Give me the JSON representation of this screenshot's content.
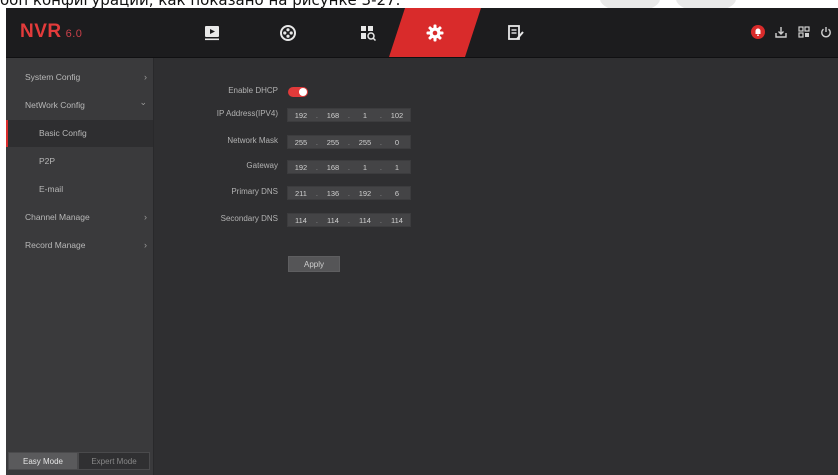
{
  "caption": {
    "text": "ооп конфигурации, как показано на рисунке 3-27."
  },
  "header": {
    "logo_text": "NVR",
    "logo_version": "6.0",
    "nav_icons": [
      "playback-icon",
      "channel-icon",
      "search-icon",
      "settings-icon",
      "maintenance-icon"
    ],
    "active_nav": "settings-icon",
    "right_icons": [
      "alarm-icon",
      "backup-icon",
      "qr-icon",
      "power-icon"
    ]
  },
  "sidebar": {
    "items": [
      {
        "label": "System Config",
        "chevron": "›"
      },
      {
        "label": "NetWork Config",
        "chevron": "⌄"
      },
      {
        "label": "Basic Config",
        "chevron": ""
      },
      {
        "label": "P2P",
        "chevron": ""
      },
      {
        "label": "E-mail",
        "chevron": ""
      },
      {
        "label": "Channel Manage",
        "chevron": "›"
      },
      {
        "label": "Record Manage",
        "chevron": "›"
      }
    ],
    "active_item": "Basic Config",
    "modes": [
      {
        "label": "Easy Mode",
        "active": true
      },
      {
        "label": "Expert Mode",
        "active": false
      }
    ]
  },
  "form": {
    "dhcp_label": "Enable DHCP",
    "dhcp_enabled": true,
    "fields": [
      {
        "label": "IP Address(IPV4)",
        "octets": [
          "192",
          "168",
          "1",
          "102"
        ]
      },
      {
        "label": "Network Mask",
        "octets": [
          "255",
          "255",
          "255",
          "0"
        ]
      },
      {
        "label": "Gateway",
        "octets": [
          "192",
          "168",
          "1",
          "1"
        ]
      },
      {
        "label": "Primary DNS",
        "octets": [
          "211",
          "136",
          "192",
          "6"
        ]
      },
      {
        "label": "Secondary DNS",
        "octets": [
          "114",
          "114",
          "114",
          "114"
        ]
      }
    ],
    "apply_label": "Apply"
  },
  "colors": {
    "accent": "#d92b2b",
    "background": "#2f2f31",
    "sidebar": "#3a3a3c",
    "topbar": "#1c1c1e"
  }
}
